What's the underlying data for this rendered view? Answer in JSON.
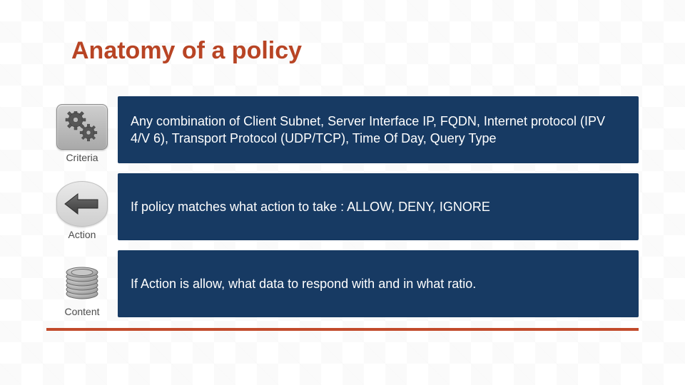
{
  "title": "Anatomy of a policy",
  "rows": [
    {
      "label": "Criteria",
      "desc": "Any combination of Client Subnet, Server Interface IP, FQDN, Internet protocol (IPV 4/V 6), Transport Protocol (UDP/TCP), Time Of Day, Query Type",
      "icon": "gears"
    },
    {
      "label": "Action",
      "desc": "If policy matches what action to take : ALLOW, DENY, IGNORE",
      "icon": "arrow-left"
    },
    {
      "label": "Content",
      "desc": "If Action is allow, what data to respond with and in what ratio.",
      "icon": "coins"
    }
  ],
  "colors": {
    "title": "#b84424",
    "panel": "#173a63",
    "accent_bar": "#c24a2b"
  }
}
